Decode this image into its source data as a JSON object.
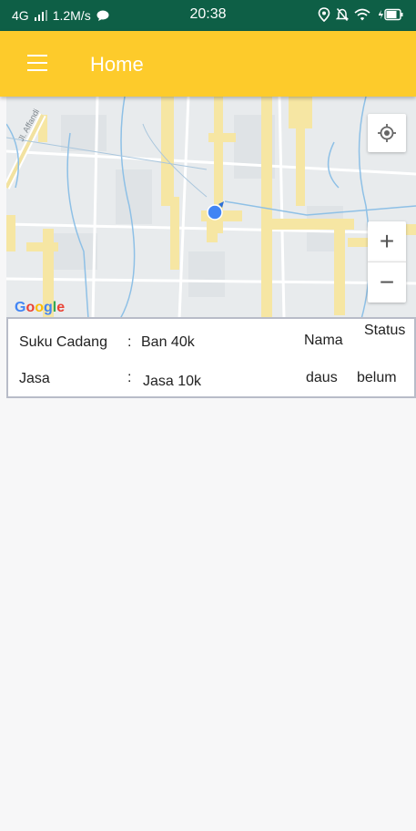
{
  "status_bar": {
    "network": "4G",
    "speed": "1.2M/s",
    "time": "20:38",
    "bg_color": "#0e5f46"
  },
  "toolbar": {
    "title": "Home",
    "bg_color": "#fdcb2b",
    "menu_icon": "hamburger-icon"
  },
  "map": {
    "attribution": "Google",
    "street_label": "Jl. Affandi",
    "controls": {
      "locate_icon": "my-location-icon",
      "zoom_in": "+",
      "zoom_out": "−"
    }
  },
  "info": {
    "spare_part_label": "Suku Cadang",
    "spare_part_colon": ":",
    "spare_part_value": "Ban 40k",
    "service_label": "Jasa",
    "service_colon": ":",
    "service_value": "Jasa 10k",
    "name_header": "Nama",
    "name_value": "daus",
    "status_header": "Status",
    "status_value": "belum"
  }
}
